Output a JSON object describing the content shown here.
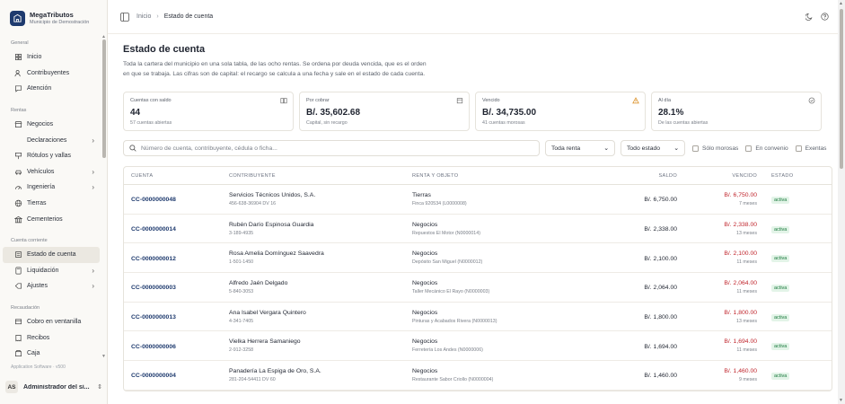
{
  "brand": {
    "name": "MegaTributos",
    "subtitle": "Municipio de Demostración"
  },
  "sidebar": {
    "groups": [
      {
        "label": "General",
        "items": [
          {
            "label": "Inicio",
            "icon": "home-icon"
          },
          {
            "label": "Contribuyentes",
            "icon": "users-icon"
          },
          {
            "label": "Atención",
            "icon": "message-icon"
          }
        ]
      },
      {
        "label": "Rentas",
        "items": [
          {
            "label": "Negocios",
            "icon": "store-icon"
          },
          {
            "label": "Declaraciones",
            "icon": "none",
            "chevron": true
          },
          {
            "label": "Rótulos y vallas",
            "icon": "sign-icon"
          },
          {
            "label": "Vehículos",
            "icon": "car-icon",
            "chevron": true
          },
          {
            "label": "Ingeniería",
            "icon": "gauge-icon",
            "chevron": true
          },
          {
            "label": "Tierras",
            "icon": "globe-icon"
          },
          {
            "label": "Cementerios",
            "icon": "building-icon"
          }
        ]
      },
      {
        "label": "Cuenta corriente",
        "items": [
          {
            "label": "Estado de cuenta",
            "icon": "ledger-icon",
            "active": true
          },
          {
            "label": "Liquidación",
            "icon": "calculator-icon",
            "chevron": true
          },
          {
            "label": "Ajustes",
            "icon": "adjust-icon",
            "chevron": true
          }
        ]
      },
      {
        "label": "Recaudación",
        "items": [
          {
            "label": "Cobro en ventanilla",
            "icon": "window-icon"
          },
          {
            "label": "Recibos",
            "icon": "receipt-icon"
          },
          {
            "label": "Caja",
            "icon": "cashbox-icon"
          }
        ]
      }
    ],
    "footer_label": "Application Software · v500",
    "user": {
      "initials": "AS",
      "name": "Administrador del si..."
    }
  },
  "topbar": {
    "crumb_home": "Inicio",
    "crumb_current": "Estado de cuenta",
    "separator": "›"
  },
  "page": {
    "title": "Estado de cuenta",
    "description": "Toda la cartera del municipio en una sola tabla, de las ocho rentas. Se ordena por deuda vencida, que es el orden en que se trabaja. Las cifras son de capital: el recargo se calcula a una fecha y sale en el estado de cada cuenta."
  },
  "cards": [
    {
      "label": "Cuentas con saldo",
      "value": "44",
      "sub": "57 cuentas abiertas",
      "icon": "book-icon"
    },
    {
      "label": "Por cobrar",
      "value": "B/. 35,602.68",
      "sub": "Capital, sin recargo",
      "icon": "calendar-icon"
    },
    {
      "label": "Vencido",
      "value": "B/. 34,735.00",
      "sub": "41 cuentas morosas",
      "icon": "warning-icon",
      "icon_color": "#d98a1a"
    },
    {
      "label": "Al día",
      "value": "28.1%",
      "sub": "De las cuentas abiertas",
      "icon": "check-circle-icon"
    }
  ],
  "filters": {
    "search_placeholder": "Número de cuenta, contribuyente, cédula o ficha...",
    "renta_select": "Toda renta",
    "estado_select": "Todo estado",
    "checkboxes": [
      "Sólo morosas",
      "En convenio",
      "Exentas"
    ]
  },
  "table": {
    "headers": [
      "CUENTA",
      "CONTRIBUYENTE",
      "RENTA Y OBJETO",
      "SALDO",
      "VENCIDO",
      "ESTADO"
    ],
    "rows": [
      {
        "cuenta": "CC-0000000048",
        "nombre": "Servicios Técnicos Unidos, S.A.",
        "id": "456-638-36904 DV 16",
        "renta": "Tierras",
        "objeto": "Finca 920534 (L0000008)",
        "saldo": "B/. 6,750.00",
        "vencido": "B/. 6,750.00",
        "meses": "7 meses",
        "estado": "activa"
      },
      {
        "cuenta": "CC-0000000014",
        "nombre": "Rubén Darío Espinosa Guardia",
        "id": "3-189-4935",
        "renta": "Negocios",
        "objeto": "Repuestos El Motor (N0000014)",
        "saldo": "B/. 2,338.00",
        "vencido": "B/. 2,338.00",
        "meses": "13 meses",
        "estado": "activa"
      },
      {
        "cuenta": "CC-0000000012",
        "nombre": "Rosa Amelia Domínguez Saavedra",
        "id": "1-501-1450",
        "renta": "Negocios",
        "objeto": "Depósito San Miguel (N0000012)",
        "saldo": "B/. 2,100.00",
        "vencido": "B/. 2,100.00",
        "meses": "11 meses",
        "estado": "activa"
      },
      {
        "cuenta": "CC-0000000003",
        "nombre": "Alfredo Jaén Delgado",
        "id": "5-840-3053",
        "renta": "Negocios",
        "objeto": "Taller Mecánico El Rayo (N0000003)",
        "saldo": "B/. 2,064.00",
        "vencido": "B/. 2,064.00",
        "meses": "11 meses",
        "estado": "activa"
      },
      {
        "cuenta": "CC-0000000013",
        "nombre": "Ana Isabel Vergara Quintero",
        "id": "4-341-7405",
        "renta": "Negocios",
        "objeto": "Pinturas y Acabados Rivera (N0000013)",
        "saldo": "B/. 1,800.00",
        "vencido": "B/. 1,800.00",
        "meses": "13 meses",
        "estado": "activa"
      },
      {
        "cuenta": "CC-0000000006",
        "nombre": "Vielka Herrera Samaniego",
        "id": "2-912-3258",
        "renta": "Negocios",
        "objeto": "Ferretería Los Andes (N0000006)",
        "saldo": "B/. 1,694.00",
        "vencido": "B/. 1,694.00",
        "meses": "11 meses",
        "estado": "activa"
      },
      {
        "cuenta": "CC-0000000004",
        "nombre": "Panadería La Espiga de Oro, S.A.",
        "id": "281-204-54411 DV 60",
        "renta": "Negocios",
        "objeto": "Restaurante Sabor Criollo (N0000004)",
        "saldo": "B/. 1,460.00",
        "vencido": "B/. 1,460.00",
        "meses": "9 meses",
        "estado": "activa"
      }
    ]
  },
  "colors": {
    "accent": "#1e3a6e",
    "danger": "#c0262d",
    "success": "#1b7a3e",
    "warning": "#d98a1a"
  }
}
